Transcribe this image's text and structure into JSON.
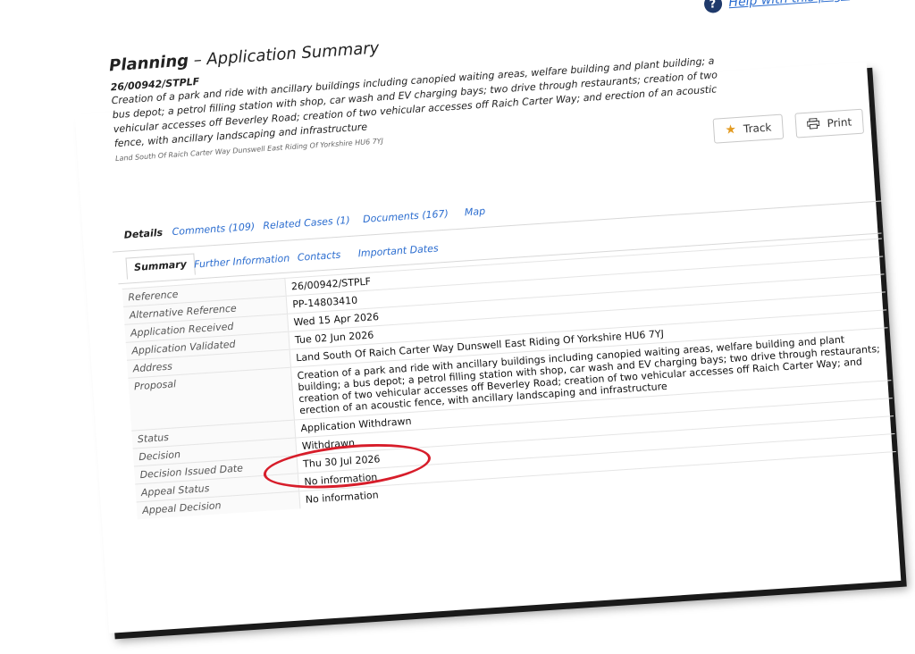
{
  "help": {
    "label": "Help with this page"
  },
  "heading": {
    "strong": "Planning",
    "rest": " – Application Summary"
  },
  "summary": {
    "reference": "26/00942/STPLF",
    "description": "Creation of a park and ride with ancillary buildings including canopied waiting areas, welfare building and plant building; a bus depot; a petrol filling station with shop, car wash and EV charging bays; two drive through restaurants; creation of two vehicular accesses off Beverley Road; creation of two vehicular accesses off Raich Carter Way; and erection of an acoustic fence, with ancillary landscaping and infrastructure",
    "address": "Land South Of Raich Carter Way Dunswell East Riding Of Yorkshire HU6 7YJ"
  },
  "buttons": {
    "track": "Track",
    "print": "Print"
  },
  "tabs": [
    {
      "label": "Details",
      "active": true
    },
    {
      "label": "Comments (109)"
    },
    {
      "label": "Related Cases (1)"
    },
    {
      "label": "Documents (167)"
    },
    {
      "label": "Map"
    }
  ],
  "subtabs": [
    {
      "label": "Summary",
      "active": true
    },
    {
      "label": "Further Information"
    },
    {
      "label": "Contacts"
    },
    {
      "label": "Important Dates"
    }
  ],
  "details": [
    {
      "label": "Reference",
      "value": "26/00942/STPLF"
    },
    {
      "label": "Alternative Reference",
      "value": "PP-14803410"
    },
    {
      "label": "Application Received",
      "value": "Wed 15 Apr 2026"
    },
    {
      "label": "Application Validated",
      "value": "Tue 02 Jun 2026"
    },
    {
      "label": "Address",
      "value": "Land South Of Raich Carter Way Dunswell East Riding Of Yorkshire HU6 7YJ"
    },
    {
      "label": "Proposal",
      "value": "Creation of a park and ride with ancillary buildings including canopied waiting areas, welfare building and plant building; a bus depot; a petrol filling station with shop, car wash and EV charging bays; two drive through restaurants; creation of two vehicular accesses off Beverley Road; creation of two vehicular accesses off Raich Carter Way; and erection of an acoustic fence, with ancillary landscaping and infrastructure"
    },
    {
      "label": "Status",
      "value": "Application Withdrawn"
    },
    {
      "label": "Decision",
      "value": "Withdrawn"
    },
    {
      "label": "Decision Issued Date",
      "value": "Thu 30 Jul 2026"
    },
    {
      "label": "Appeal Status",
      "value": "No information"
    },
    {
      "label": "Appeal Decision",
      "value": "No information"
    }
  ],
  "colors": {
    "link": "#2a6ccf",
    "annotation": "#d71d2a",
    "star": "#e39b22"
  },
  "icons": [
    "help-icon",
    "star-icon",
    "print-icon"
  ]
}
